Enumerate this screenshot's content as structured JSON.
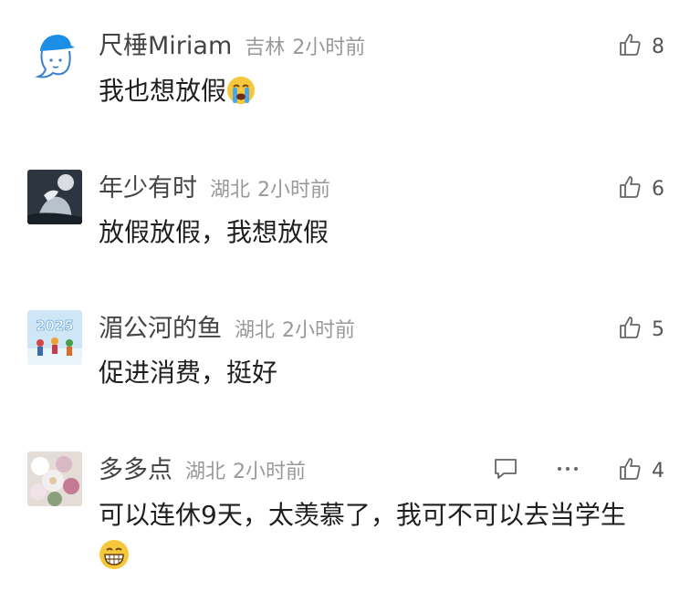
{
  "comments": [
    {
      "username": "尺棰Miriam",
      "location": "吉林",
      "time": "2小时前",
      "likes": "8",
      "text": "我也想放假",
      "emoji": "loudly-crying-face"
    },
    {
      "username": "年少有时",
      "location": "湖北",
      "time": "2小时前",
      "likes": "6",
      "text": "放假放假，我想放假"
    },
    {
      "username": "湄公河的鱼",
      "location": "湖北",
      "time": "2小时前",
      "likes": "5",
      "text": "促进消费，挺好",
      "avatar_text": "2025"
    },
    {
      "username": "多多点",
      "location": "湖北",
      "time": "2小时前",
      "likes": "4",
      "text": "可以连休9天，太羡慕了，我可不可以去当学生",
      "emoji": "grinning-face-with-teeth"
    }
  ],
  "colors": {
    "username": "#444444",
    "meta": "#999999",
    "text": "#1f1f1f",
    "icon": "#666666"
  },
  "icons": {
    "like": "thumbs-up-icon",
    "reply": "comment-bubble-icon",
    "more": "more-dots-icon"
  }
}
